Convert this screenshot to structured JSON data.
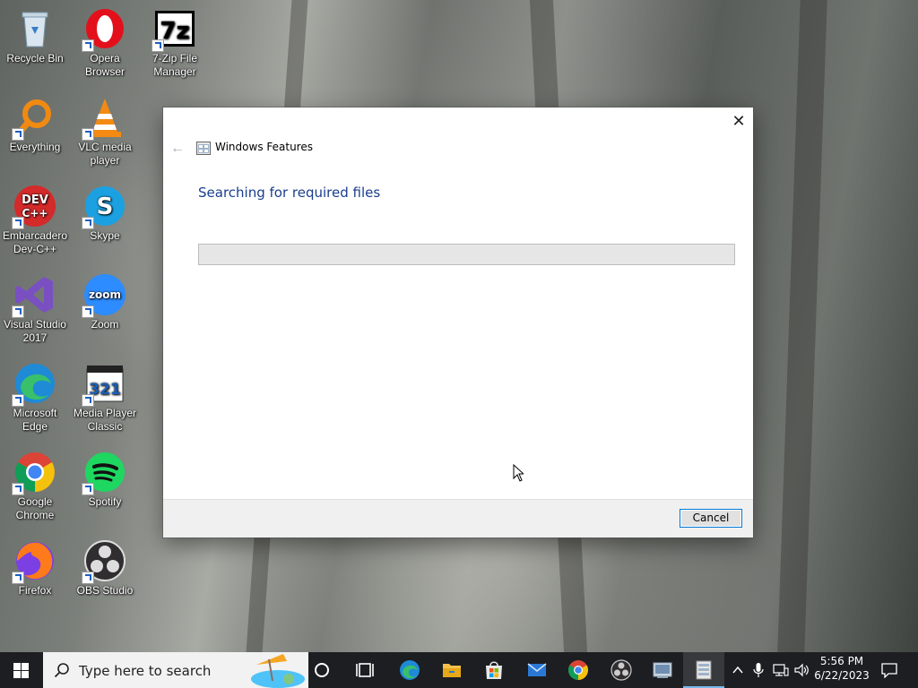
{
  "desktop": {
    "icons": [
      {
        "label": "Recycle Bin",
        "icon": "recycle-bin-icon"
      },
      {
        "label": "Opera Browser",
        "icon": "opera-icon"
      },
      {
        "label": "7-Zip File Manager",
        "icon": "7zip-icon"
      },
      {
        "label": "Everything",
        "icon": "everything-icon"
      },
      {
        "label": "VLC media player",
        "icon": "vlc-icon"
      },
      {
        "label": "Embarcadero Dev-C++",
        "icon": "devcpp-icon"
      },
      {
        "label": "Skype",
        "icon": "skype-icon"
      },
      {
        "label": "Visual Studio 2017",
        "icon": "visual-studio-icon"
      },
      {
        "label": "Zoom",
        "icon": "zoom-icon"
      },
      {
        "label": "Microsoft Edge",
        "icon": "edge-icon"
      },
      {
        "label": "Media Player Classic",
        "icon": "mpc-icon"
      },
      {
        "label": "Google Chrome",
        "icon": "chrome-icon"
      },
      {
        "label": "Spotify",
        "icon": "spotify-icon"
      },
      {
        "label": "Firefox",
        "icon": "firefox-icon"
      },
      {
        "label": "OBS Studio",
        "icon": "obs-icon"
      }
    ]
  },
  "dialog": {
    "title": "Windows Features",
    "heading": "Searching for required files",
    "progress": 0,
    "cancel_label": "Cancel",
    "close_glyph": "✕",
    "back_glyph": "←"
  },
  "taskbar": {
    "search_placeholder": "Type here to search",
    "time": "5:56 PM",
    "date": "6/22/2023",
    "pinned": [
      "cortana-icon",
      "task-view-icon",
      "edge-icon",
      "file-explorer-icon",
      "microsoft-store-icon",
      "mail-icon",
      "chrome-icon",
      "obs-icon",
      "control-panel-icon",
      "windows-features-icon"
    ]
  },
  "colors": {
    "accent": "#0078d7",
    "heading": "#1a3e8e",
    "taskbar": "#1c1e22"
  }
}
